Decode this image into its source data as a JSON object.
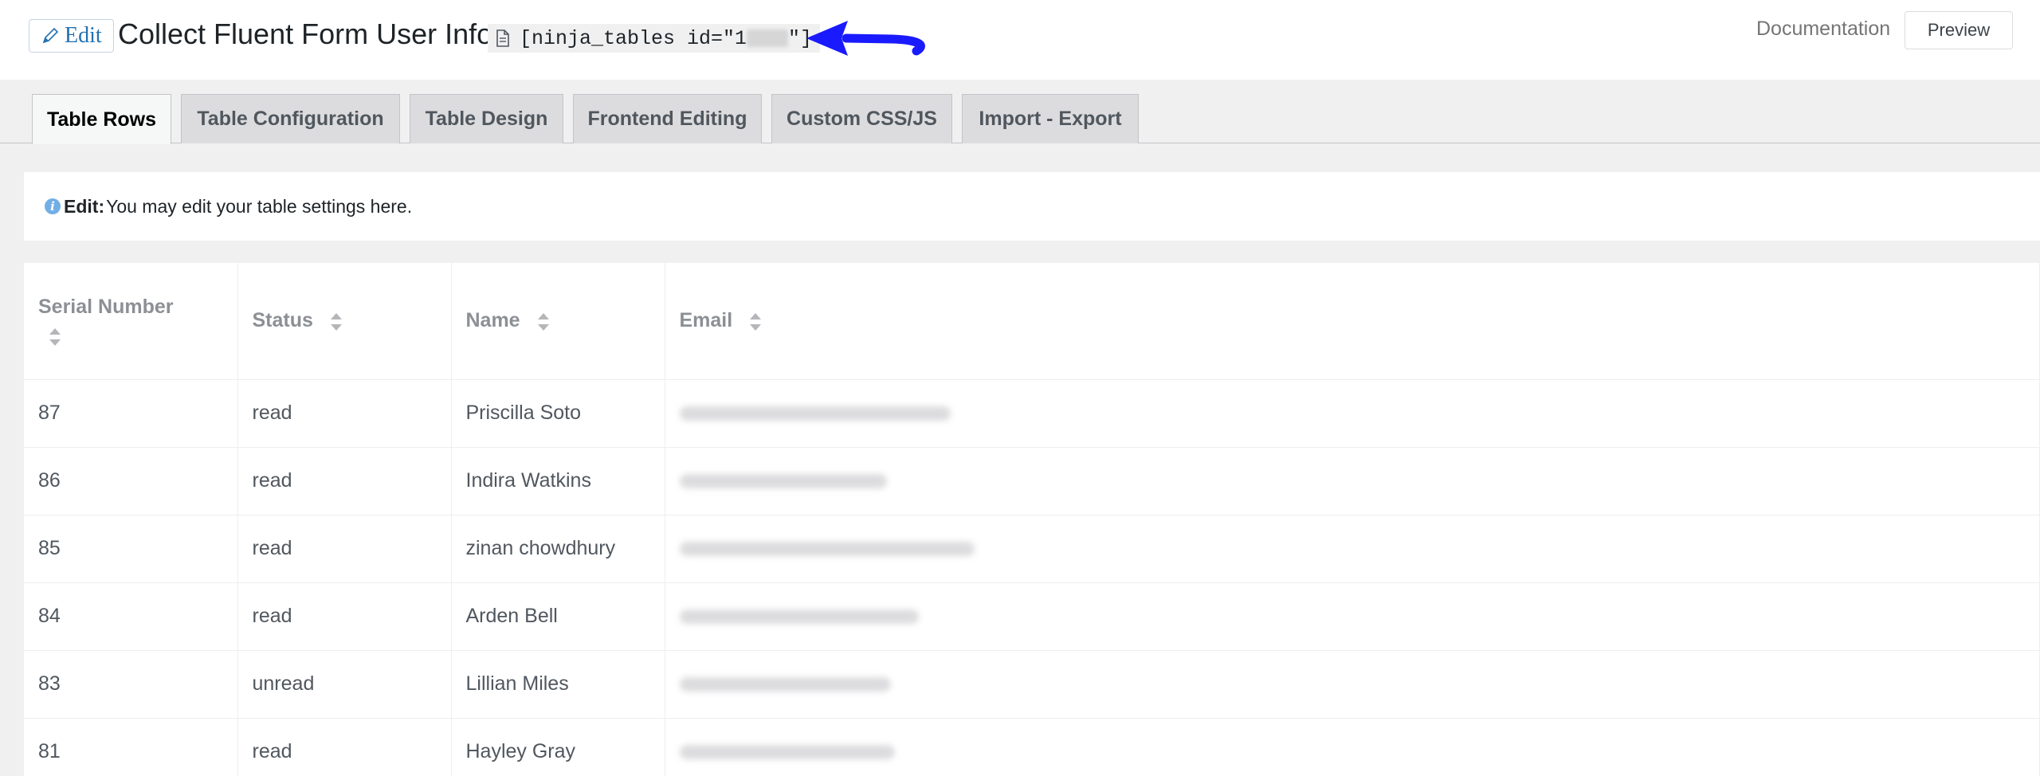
{
  "header": {
    "edit_label": "Edit",
    "title": "Collect Fluent Form User Info",
    "shortcode_prefix": "[ninja_tables id=\"1",
    "shortcode_suffix": "\"]",
    "documentation_label": "Documentation",
    "preview_label": "Preview"
  },
  "tabs": [
    {
      "label": "Table Rows",
      "active": true
    },
    {
      "label": "Table Configuration",
      "active": false
    },
    {
      "label": "Table Design",
      "active": false
    },
    {
      "label": "Frontend Editing",
      "active": false
    },
    {
      "label": "Custom CSS/JS",
      "active": false
    },
    {
      "label": "Import - Export",
      "active": false
    }
  ],
  "notice": {
    "strong": "Edit:",
    "text": "You may edit your table settings here."
  },
  "table": {
    "headers": [
      "Serial Number",
      "Status",
      "Name",
      "Email"
    ],
    "rows": [
      {
        "serial": "87",
        "status": "read",
        "name": "Priscilla Soto"
      },
      {
        "serial": "86",
        "status": "read",
        "name": "Indira Watkins"
      },
      {
        "serial": "85",
        "status": "read",
        "name": "zinan chowdhury"
      },
      {
        "serial": "84",
        "status": "read",
        "name": "Arden Bell"
      },
      {
        "serial": "83",
        "status": "unread",
        "name": "Lillian Miles"
      },
      {
        "serial": "81",
        "status": "read",
        "name": "Hayley Gray"
      }
    ]
  },
  "colors": {
    "accent": "#2271b1",
    "arrow": "#1a1aff",
    "info": "#72aee6"
  }
}
